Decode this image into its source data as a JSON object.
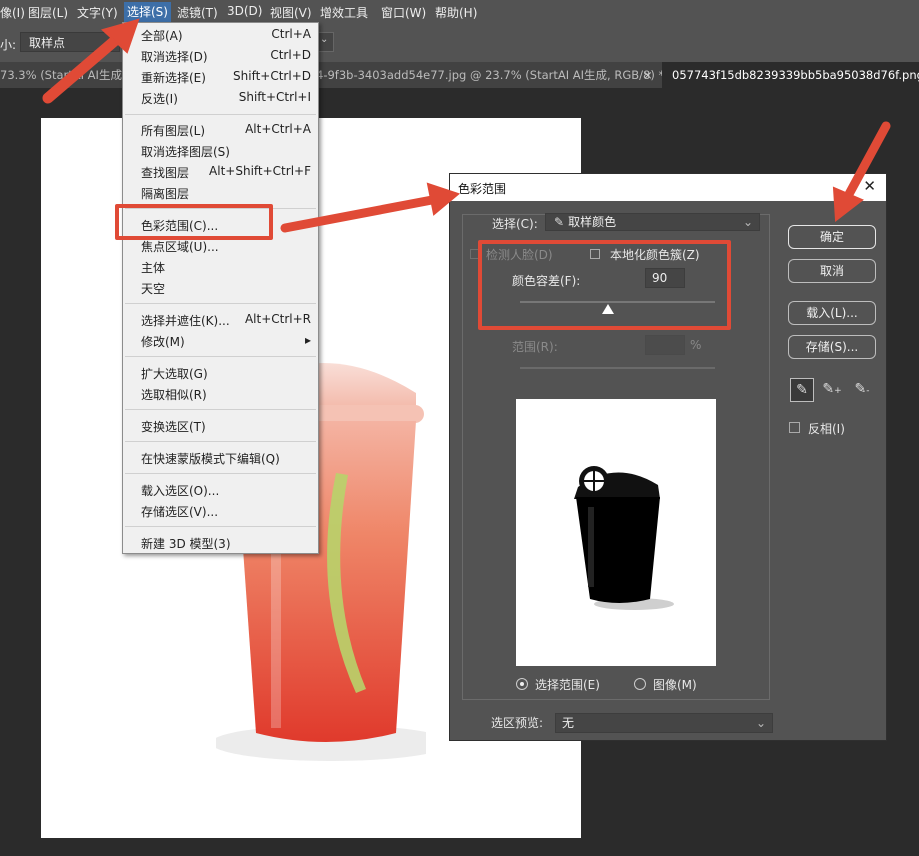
{
  "menubar": {
    "items": [
      "像(I)",
      "图层(L)",
      "文字(Y)",
      "选择(S)",
      "滤镜(T)",
      "3D(D)",
      "视图(V)",
      "增效工具",
      "窗口(W)",
      "帮助(H)"
    ]
  },
  "options": {
    "label": "小:",
    "sample": "取样点"
  },
  "tabs": [
    "73.3% (StartAI AI生成,",
    "4-9f3b-3403add54e77.jpg @ 23.7% (StartAI AI生成, RGB/8) *",
    "×",
    "057743f15db8239339bb5ba95038d76f.png @"
  ],
  "select_menu": {
    "items": [
      {
        "label": "全部(A)",
        "shortcut": "Ctrl+A"
      },
      {
        "label": "取消选择(D)",
        "shortcut": "Ctrl+D"
      },
      {
        "label": "重新选择(E)",
        "shortcut": "Shift+Ctrl+D"
      },
      {
        "label": "反选(I)",
        "shortcut": "Shift+Ctrl+I"
      },
      {
        "label": "所有图层(L)",
        "shortcut": "Alt+Ctrl+A"
      },
      {
        "label": "取消选择图层(S)",
        "shortcut": ""
      },
      {
        "label": "查找图层",
        "shortcut": "Alt+Shift+Ctrl+F"
      },
      {
        "label": "隔离图层",
        "shortcut": ""
      },
      {
        "label": "色彩范围(C)...",
        "shortcut": ""
      },
      {
        "label": "焦点区域(U)...",
        "shortcut": ""
      },
      {
        "label": "主体",
        "shortcut": ""
      },
      {
        "label": "天空",
        "shortcut": ""
      },
      {
        "label": "选择并遮住(K)...",
        "shortcut": "Alt+Ctrl+R"
      },
      {
        "label": "修改(M)",
        "shortcut": "▸"
      },
      {
        "label": "扩大选取(G)",
        "shortcut": ""
      },
      {
        "label": "选取相似(R)",
        "shortcut": ""
      },
      {
        "label": "变换选区(T)",
        "shortcut": ""
      },
      {
        "label": "在快速蒙版模式下编辑(Q)",
        "shortcut": ""
      },
      {
        "label": "载入选区(O)...",
        "shortcut": ""
      },
      {
        "label": "存储选区(V)...",
        "shortcut": ""
      },
      {
        "label": "新建 3D 模型(3)",
        "shortcut": ""
      }
    ]
  },
  "dialog": {
    "title": "色彩范围",
    "close": "✕",
    "select_label": "选择(C):",
    "select_value": "取样颜色",
    "detect_faces": "检测人脸(D)",
    "localized": "本地化颜色簇(Z)",
    "fuzziness_label": "颜色容差(F):",
    "fuzziness_value": "90",
    "fuzziness_level": 0.45,
    "range_label": "范围(R):",
    "range_unit": "%",
    "radio_selection": "选择范围(E)",
    "radio_image": "图像(M)",
    "preview_label": "选区预览:",
    "preview_value": "无",
    "buttons": {
      "ok": "确定",
      "cancel": "取消",
      "load": "载入(L)...",
      "save": "存储(S)..."
    },
    "invert": "反相(I)"
  },
  "colors": {
    "annotation": "#e04a36",
    "menu_highlight": "#3d6fa8"
  }
}
